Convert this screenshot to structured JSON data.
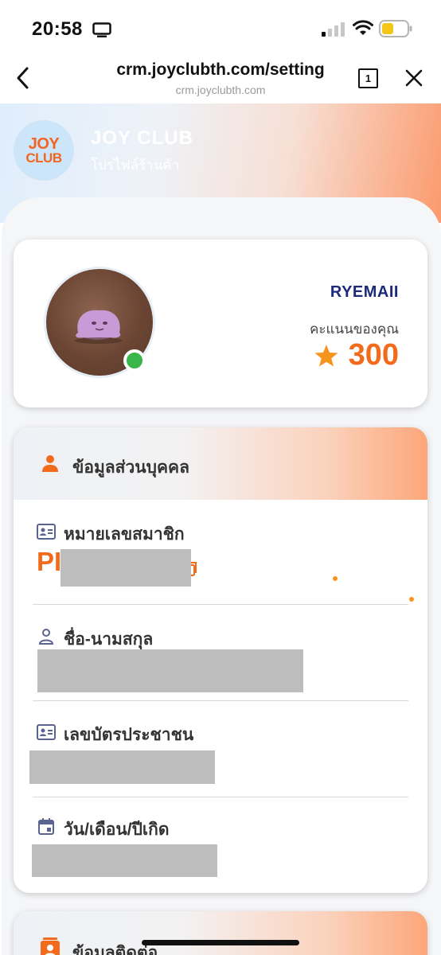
{
  "status_bar": {
    "time": "20:58",
    "icons": [
      "screen-mirroring-icon",
      "cellular-signal-icon",
      "wifi-icon",
      "battery-icon"
    ],
    "battery_color": "#f5c518"
  },
  "browser": {
    "url_main": "crm.joyclubth.com/setting",
    "url_sub": "crm.joyclubth.com",
    "tab_count": "1"
  },
  "header": {
    "logo_line1": "JOY",
    "logo_line2": "CLUB",
    "brand_name": "JOY CLUB",
    "subtitle": "โปรไฟล์ร้านค้า"
  },
  "profile": {
    "username": "RYEMAII",
    "points_label": "คะแนนของคุณ",
    "points": "300",
    "online_status_color": "#3ab54a"
  },
  "personal_info": {
    "title": "ข้อมูลส่วนบุคคล",
    "fields": [
      {
        "label": "หมายเลขสมาชิก",
        "icon": "id-card-icon",
        "value_visible": "PI"
      },
      {
        "label": "ชื่อ-นามสกุล",
        "icon": "person-outline-icon"
      },
      {
        "label": "เลขบัตรประชาชน",
        "icon": "id-card-icon"
      },
      {
        "label": "วัน/เดือน/ปีเกิด",
        "icon": "calendar-icon"
      }
    ]
  },
  "contact_info": {
    "title": "ข้อมูลติดต่อ"
  },
  "colors": {
    "accent_orange": "#f26b1d",
    "username_navy": "#1c2a7a",
    "icon_slate": "#5b6391"
  }
}
